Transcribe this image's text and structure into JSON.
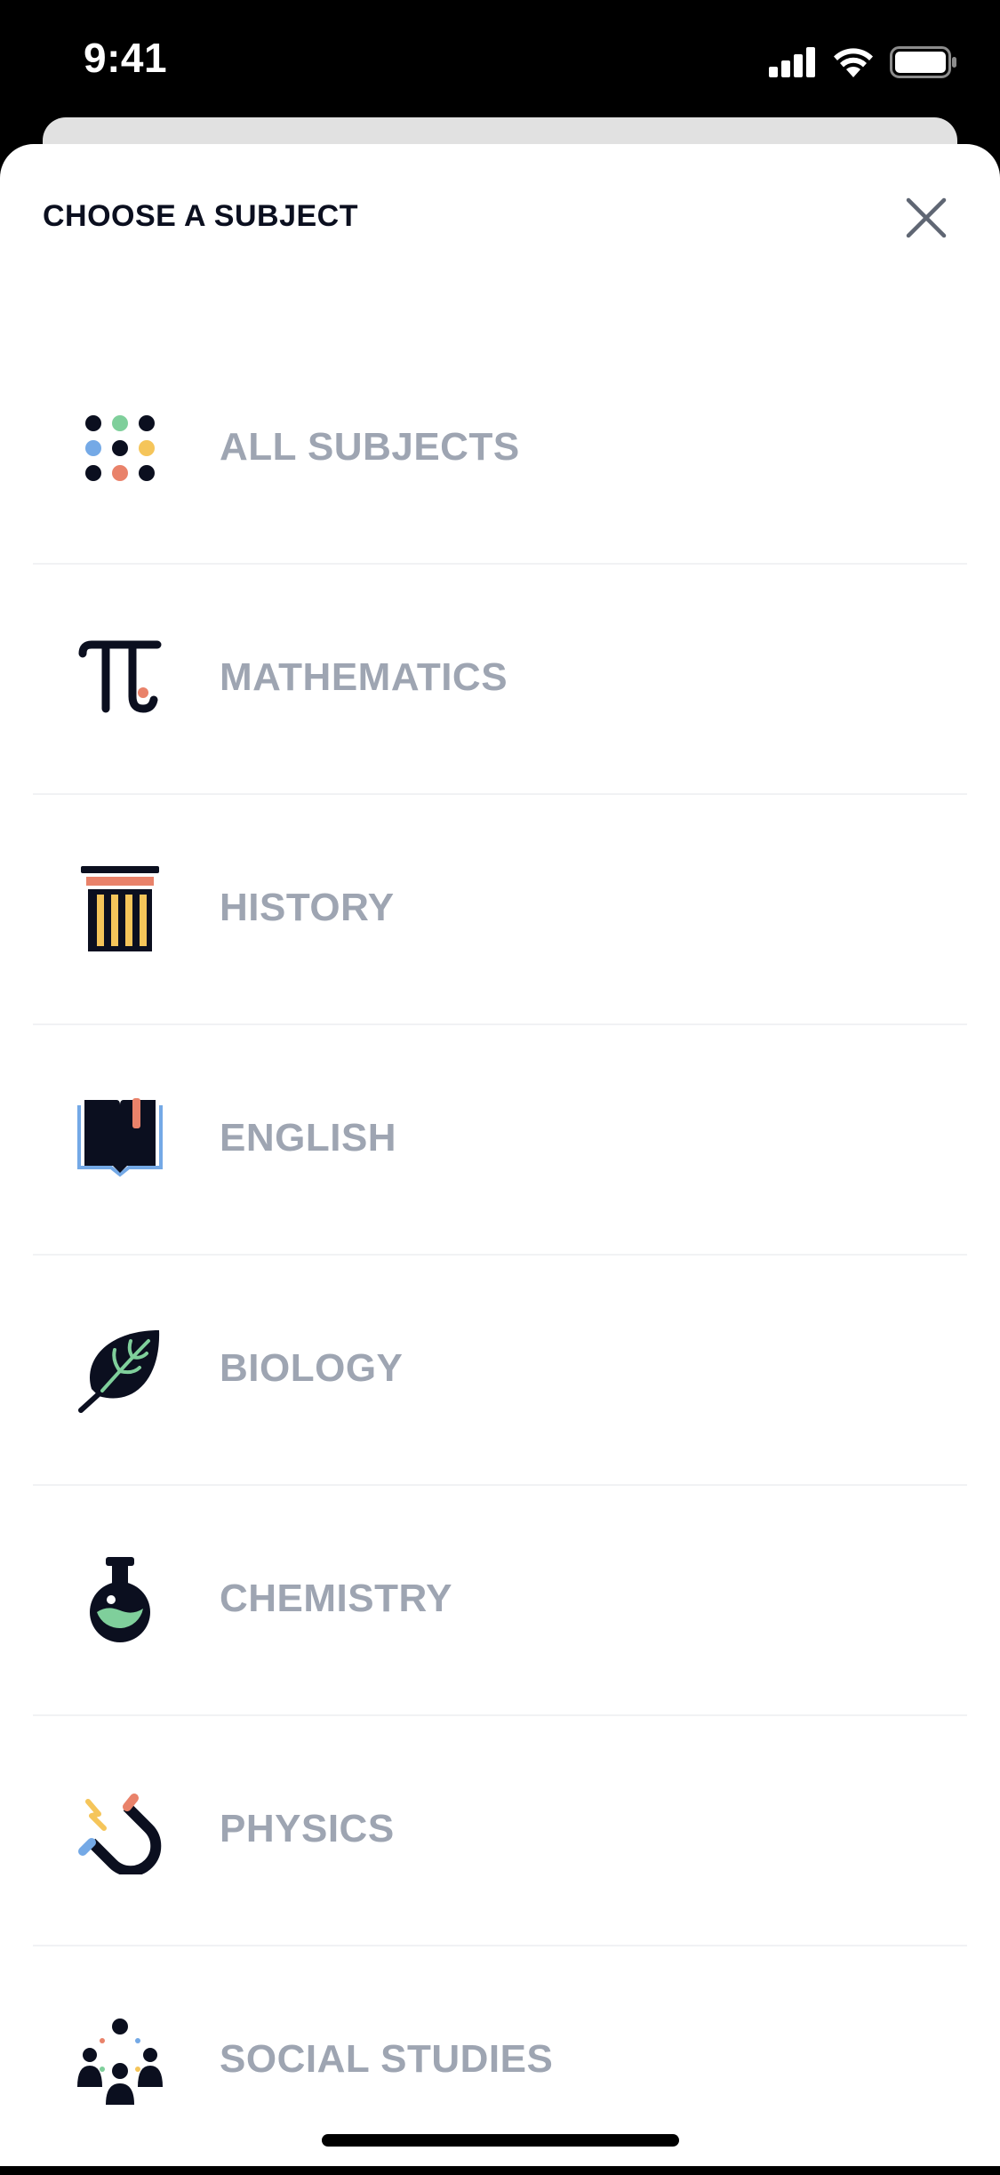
{
  "status_bar": {
    "time": "9:41",
    "icons": [
      "cellular-signal-icon",
      "wifi-icon",
      "battery-icon"
    ]
  },
  "sheet": {
    "title": "CHOOSE A SUBJECT",
    "close_icon": "close-icon"
  },
  "subjects": [
    {
      "label": "ALL SUBJECTS",
      "icon": "dots-grid-icon"
    },
    {
      "label": "MATHEMATICS",
      "icon": "pi-icon"
    },
    {
      "label": "HISTORY",
      "icon": "column-icon"
    },
    {
      "label": "ENGLISH",
      "icon": "book-icon"
    },
    {
      "label": "BIOLOGY",
      "icon": "leaf-icon"
    },
    {
      "label": "CHEMISTRY",
      "icon": "flask-icon"
    },
    {
      "label": "PHYSICS",
      "icon": "magnet-icon"
    },
    {
      "label": "SOCIAL STUDIES",
      "icon": "people-icon"
    }
  ],
  "colors": {
    "label": "#9ea5b2",
    "title": "#0b0f1f",
    "icon_dark": "#0b0f1f",
    "accent_green": "#7fcf9b",
    "accent_blue": "#74a9e6",
    "accent_yellow": "#f5c55a",
    "accent_coral": "#e9826a",
    "divider": "#f1f2f4"
  }
}
